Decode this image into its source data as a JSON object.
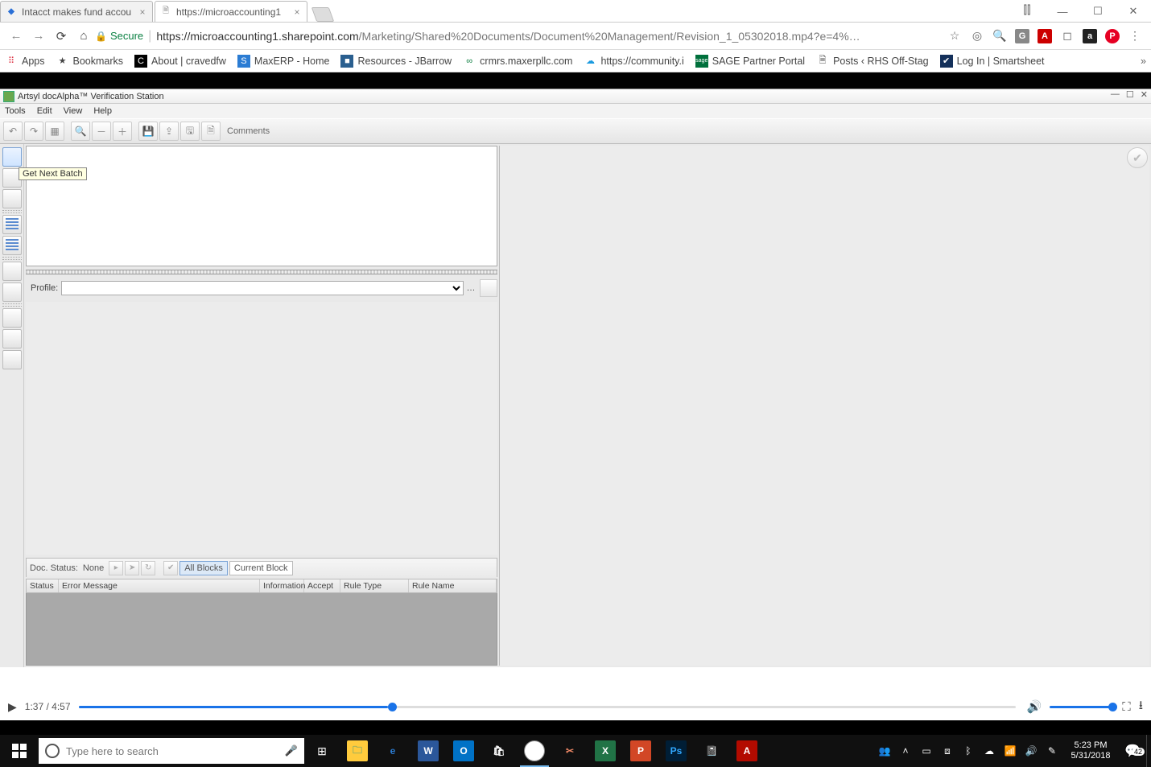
{
  "browser": {
    "tabs": [
      {
        "title": "Intacct makes fund accou",
        "favicon": "◆"
      },
      {
        "title": "https://microaccounting1",
        "favicon": "🗎"
      }
    ],
    "url_host": "https://microaccounting1.sharepoint.com",
    "url_path": "/Marketing/Shared%20Documents/Document%20Management/Revision_1_05302018.mp4?e=4%…",
    "secure_label": "Secure",
    "bookmarks": [
      {
        "label": "Apps",
        "icon": "⋮⋮"
      },
      {
        "label": "Bookmarks",
        "icon": "★"
      },
      {
        "label": "About | cravedfw",
        "icon": "C"
      },
      {
        "label": "MaxERP - Home",
        "icon": "S"
      },
      {
        "label": "Resources - JBarrow",
        "icon": "■"
      },
      {
        "label": "crmrs.maxerpllc.com",
        "icon": "∞"
      },
      {
        "label": "https://community.i",
        "icon": "☁"
      },
      {
        "label": "SAGE Partner Portal",
        "icon": "sage"
      },
      {
        "label": "Posts ‹ RHS Off-Stag",
        "icon": "🗎"
      },
      {
        "label": "Log In | Smartsheet",
        "icon": "✔"
      }
    ]
  },
  "app": {
    "title": "Artsyl docAlpha™ Verification Station",
    "menu": [
      "Tools",
      "Edit",
      "View",
      "Help"
    ],
    "toolbar_comments": "Comments",
    "tooltip": "Get Next Batch",
    "profile_label": "Profile:",
    "doc_status_label": "Doc. Status:",
    "doc_status_value": "None",
    "toggle_all": "All Blocks",
    "toggle_current": "Current Block",
    "grid_cols": {
      "status": "Status",
      "error": "Error Message",
      "info": "Information",
      "accept": "Accept",
      "ruletype": "Rule Type",
      "rulename": "Rule Name"
    }
  },
  "video": {
    "current": "1:37",
    "total": "4:57",
    "progress_pct": 33
  },
  "taskbar": {
    "search_placeholder": "Type here to search",
    "time": "5:23 PM",
    "date": "5/31/2018",
    "notifications": "42"
  }
}
